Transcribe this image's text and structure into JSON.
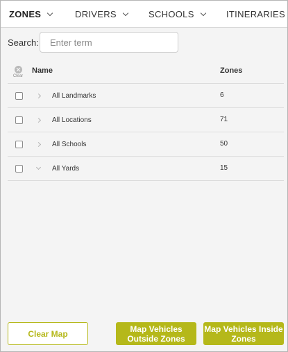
{
  "tabs": [
    {
      "label": "ZONES",
      "active": true
    },
    {
      "label": "DRIVERS",
      "active": false
    },
    {
      "label": "SCHOOLS",
      "active": false
    },
    {
      "label": "ITINERARIES",
      "active": false
    }
  ],
  "search": {
    "label": "Search:",
    "placeholder": "Enter term",
    "value": ""
  },
  "table": {
    "clear_label": "Clear",
    "columns": {
      "name": "Name",
      "zones": "Zones"
    },
    "rows": [
      {
        "name": "All Landmarks",
        "zones": "6",
        "expanded": false
      },
      {
        "name": "All Locations",
        "zones": "71",
        "expanded": false
      },
      {
        "name": "All Schools",
        "zones": "50",
        "expanded": false
      },
      {
        "name": "All Yards",
        "zones": "15",
        "expanded": true
      }
    ]
  },
  "buttons": {
    "clear_map": "Clear Map",
    "outside": "Map Vehicles Outside Zones",
    "inside": "Map Vehicles Inside Zones"
  },
  "colors": {
    "accent": "#b5b81a"
  }
}
